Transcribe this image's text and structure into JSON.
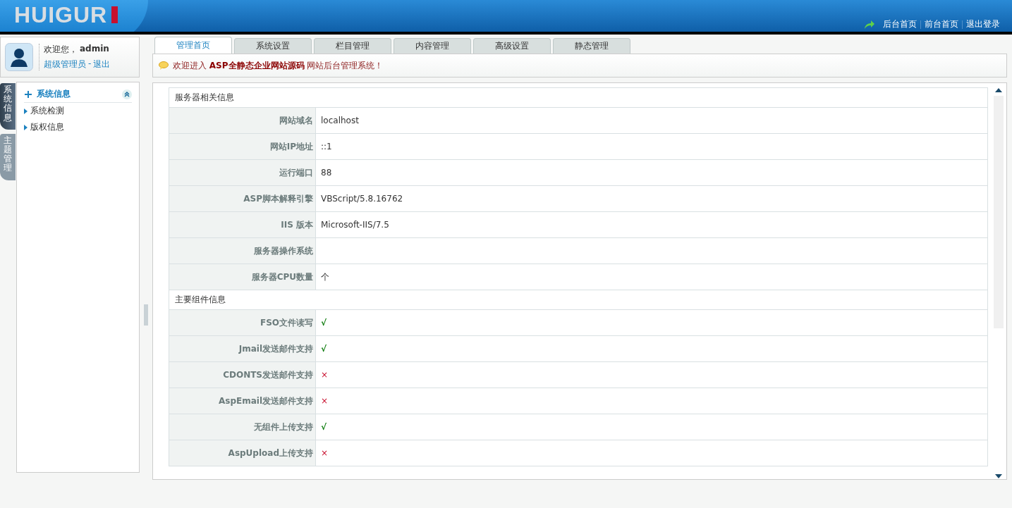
{
  "header": {
    "logo": "HUIGUR",
    "links": [
      "后台首页",
      "前台首页",
      "退出登录"
    ]
  },
  "user": {
    "greeting": "欢迎您，",
    "name": "admin",
    "role": "超级管理员",
    "separator": "-",
    "logout": "退出"
  },
  "side_tabs": [
    {
      "label": "系统信息",
      "selected": true
    },
    {
      "label": "主题管理",
      "selected": false
    }
  ],
  "menu": {
    "title": "系统信息",
    "expanded": true,
    "items": [
      "系统检测",
      "版权信息"
    ]
  },
  "tabs": [
    {
      "label": "管理首页",
      "selected": true
    },
    {
      "label": "系统设置",
      "selected": false
    },
    {
      "label": "栏目管理",
      "selected": false
    },
    {
      "label": "内容管理",
      "selected": false
    },
    {
      "label": "高级设置",
      "selected": false
    },
    {
      "label": "静态管理",
      "selected": false
    }
  ],
  "notice": "欢迎进入 **ASP全静态企业网站源码** 网站后台管理系统！",
  "sections": [
    {
      "title": "服务器相关信息",
      "rows": [
        {
          "label": "网站域名",
          "value": "localhost"
        },
        {
          "label": "网站IP地址",
          "value": "::1"
        },
        {
          "label": "运行端口",
          "value": "88"
        },
        {
          "label": "ASP脚本解释引擎",
          "value": "VBScript/5.8.16762"
        },
        {
          "label": "IIS 版本",
          "value": "Microsoft-IIS/7.5"
        },
        {
          "label": "服务器操作系统"
        },
        {
          "label": "服务器CPU数量",
          "value": "个"
        }
      ]
    },
    {
      "title": "主要组件信息",
      "rows": [
        {
          "label": "FSO文件读写",
          "value": "√",
          "supported": true
        },
        {
          "label": "Jmail发送邮件支持",
          "value": "√",
          "supported": true
        },
        {
          "label": "CDONTS发送邮件支持",
          "value": "×",
          "supported": false
        },
        {
          "label": "AspEmail发送邮件支持",
          "value": "×",
          "supported": false
        },
        {
          "label": "无组件上传支持",
          "value": "√",
          "supported": true
        },
        {
          "label": "AspUpload上传支持",
          "value": "×",
          "supported": false
        }
      ]
    }
  ]
}
